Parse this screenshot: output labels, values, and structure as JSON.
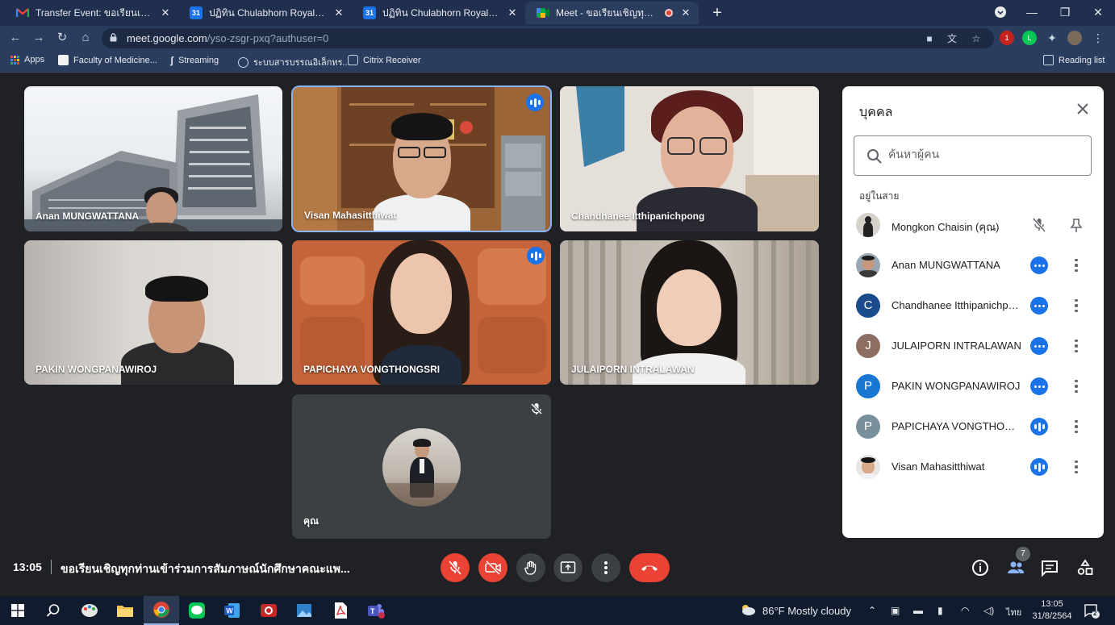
{
  "browser": {
    "tabs": [
      {
        "title": "Transfer Event: ขอเรียนเชิญทุกท่านเ",
        "icon": "gmail-icon"
      },
      {
        "title": "ปฏิทิน Chulabhorn Royal Academy",
        "icon": "calendar-icon"
      },
      {
        "title": "ปฏิทิน Chulabhorn Royal Academy",
        "icon": "calendar-icon"
      },
      {
        "title": "Meet - ขอเรียนเชิญทุกท่านเข้าร่",
        "icon": "meet-icon"
      }
    ],
    "url_host": "meet.google.com",
    "url_path": "/yso-zsgr-pxq?authuser=0",
    "bookmarks": [
      "Apps",
      "Faculty of Medicine...",
      "Streaming",
      "ระบบสารบรรณอิเล็กทร...",
      "Citrix Receiver"
    ],
    "reading_list": "Reading list",
    "ext_badge": "1"
  },
  "meet": {
    "tiles": [
      {
        "name": "Anan MUNGWATTANA"
      },
      {
        "name": "Visan Mahasitthiwat"
      },
      {
        "name": "Chandhanee Itthipanichpong"
      },
      {
        "name": "PAKIN WONGPANAWIROJ"
      },
      {
        "name": "PAPICHAYA VONGTHONGSRI"
      },
      {
        "name": "JULAIPORN INTRALAWAN"
      },
      {
        "name": "คุณ"
      }
    ],
    "panel": {
      "title": "บุคคล",
      "search_placeholder": "ค้นหาผู้คน",
      "section": "อยู่ในสาย",
      "people": [
        {
          "name": "Mongkon Chaisin (คุณ)",
          "initial": ""
        },
        {
          "name": "Anan MUNGWATTANA",
          "initial": ""
        },
        {
          "name": "Chandhanee Itthipanichpong",
          "initial": "C"
        },
        {
          "name": "JULAIPORN INTRALAWAN",
          "initial": "J"
        },
        {
          "name": "PAKIN WONGPANAWIROJ",
          "initial": "P"
        },
        {
          "name": "PAPICHAYA VONGTHONGSRI",
          "initial": "P"
        },
        {
          "name": "Visan Mahasitthiwat",
          "initial": ""
        }
      ]
    },
    "clock": "13:05",
    "meeting_title": "ขอเรียนเชิญทุกท่านเข้าร่วมการสัมภาษณ์นักศึกษาคณะแพ...",
    "participants_count": "7"
  },
  "taskbar": {
    "weather": "86°F  Mostly cloudy",
    "lang": "ไทย",
    "time": "13:05",
    "date": "31/8/2564",
    "notif": "2"
  },
  "colors": {
    "accent": "#1a73e8",
    "danger": "#ea4335",
    "stage": "#202124"
  }
}
